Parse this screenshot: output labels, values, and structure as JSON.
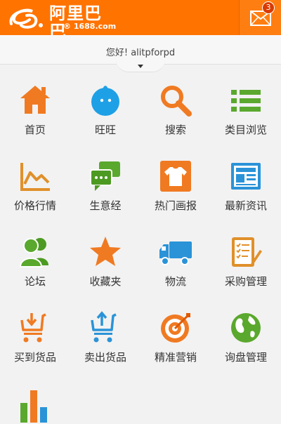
{
  "header": {
    "logo_cn": "阿里巴巴",
    "logo_domain": "® 1688.com",
    "mail_badge": "3",
    "brand_color": "#ff7300"
  },
  "greeting": {
    "text": "您好! alitpforpd"
  },
  "grid": {
    "items": [
      {
        "label": "首页",
        "icon": "home-icon"
      },
      {
        "label": "旺旺",
        "icon": "wangwang-icon"
      },
      {
        "label": "搜索",
        "icon": "search-icon"
      },
      {
        "label": "类目浏览",
        "icon": "category-list-icon"
      },
      {
        "label": "价格行情",
        "icon": "price-trend-icon"
      },
      {
        "label": "生意经",
        "icon": "chat-bubbles-icon"
      },
      {
        "label": "热门画报",
        "icon": "tshirt-icon"
      },
      {
        "label": "最新资讯",
        "icon": "news-icon"
      },
      {
        "label": "论坛",
        "icon": "forum-users-icon"
      },
      {
        "label": "收藏夹",
        "icon": "star-icon"
      },
      {
        "label": "物流",
        "icon": "truck-icon"
      },
      {
        "label": "采购管理",
        "icon": "purchase-checklist-icon"
      },
      {
        "label": "买到货品",
        "icon": "cart-in-icon"
      },
      {
        "label": "卖出货品",
        "icon": "cart-out-icon"
      },
      {
        "label": "精准营销",
        "icon": "target-icon"
      },
      {
        "label": "询盘管理",
        "icon": "globe-icon"
      },
      {
        "label": "",
        "icon": "bar-chart-icon"
      }
    ]
  }
}
